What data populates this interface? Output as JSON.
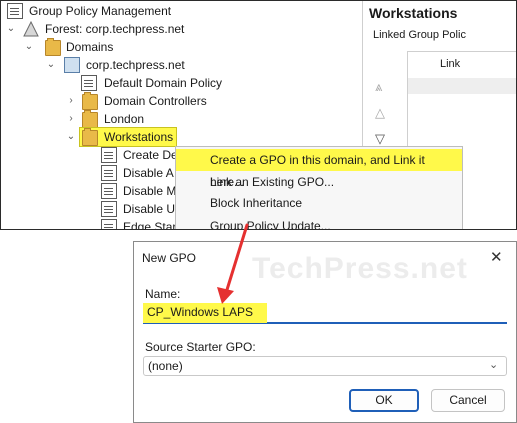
{
  "tree": {
    "root": "Group Policy Management",
    "forest": "Forest: corp.techpress.net",
    "domains": "Domains",
    "domain": "corp.techpress.net",
    "items": [
      "Default Domain Policy",
      "Domain Controllers",
      "London",
      "Workstations"
    ],
    "children": [
      "Create De",
      "Disable A",
      "Disable M",
      "Disable U",
      "Edge Star"
    ]
  },
  "right_pane": {
    "title": "Workstations",
    "tab": "Linked Group Polic",
    "column": "Link"
  },
  "context_menu": {
    "items": [
      "Create a GPO in this domain, and Link it here...",
      "Link an Existing GPO...",
      "Block Inheritance",
      "Group Policy Update..."
    ]
  },
  "dialog": {
    "title": "New GPO",
    "watermark": "TechPress.net",
    "name_label": "Name:",
    "name_value": "CP_Windows LAPS",
    "starter_label": "Source Starter GPO:",
    "starter_value": "(none)",
    "ok": "OK",
    "cancel": "Cancel"
  },
  "colors": {
    "highlight": "#fff94a",
    "arrow": "#e53030",
    "accent": "#1f5fb8"
  }
}
